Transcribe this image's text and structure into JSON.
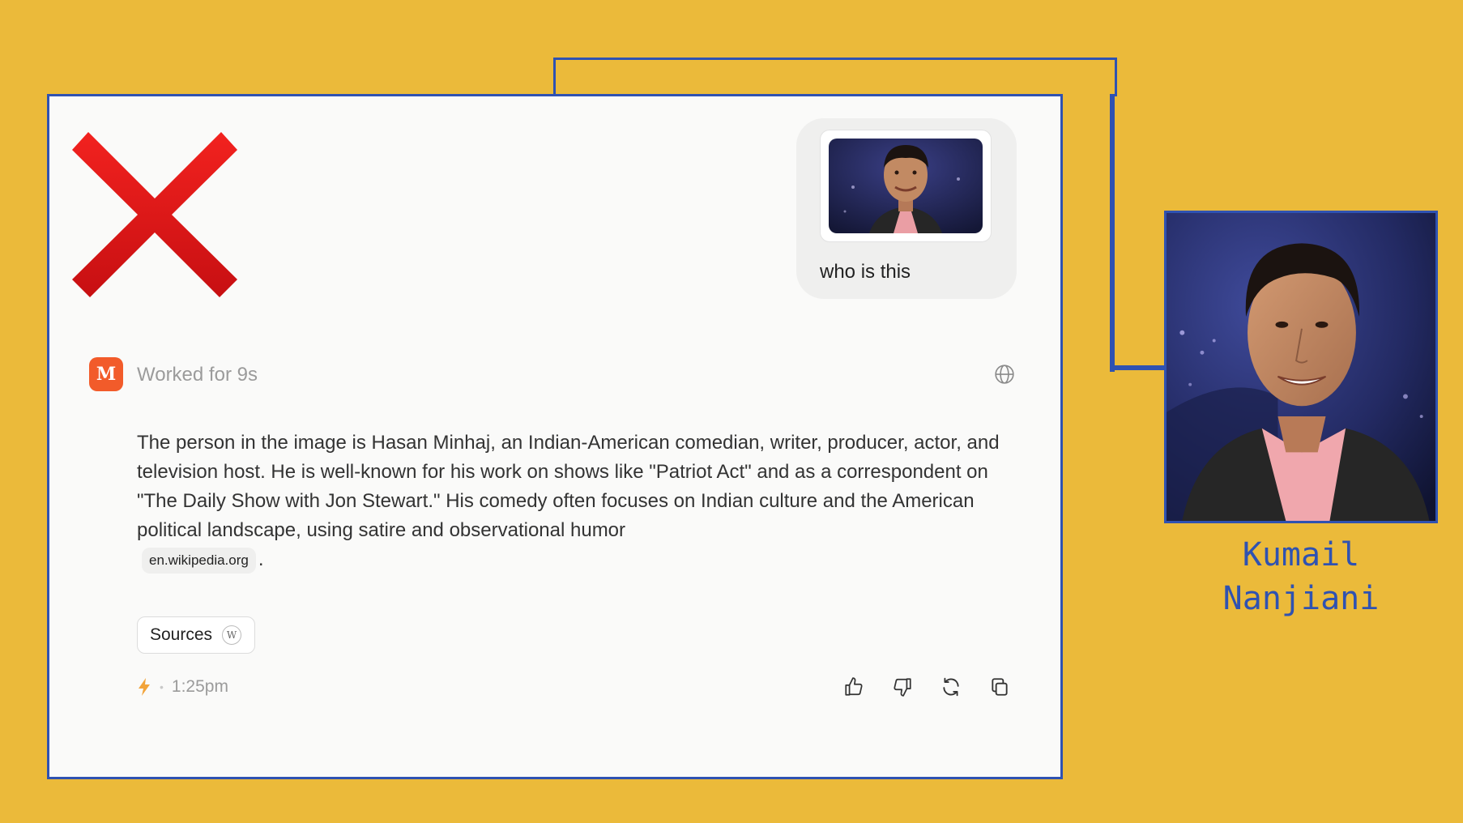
{
  "colors": {
    "background": "#ebba3a",
    "accent_blue": "#2f52b1",
    "wrong_mark": "#e0191d",
    "brand_logo": "#f25b2a",
    "lightning": "#f2a43a"
  },
  "annotation": {
    "verdict_icon": "red-x-icon",
    "correct_name": "Kumail Nanjiani"
  },
  "chat": {
    "user_message": {
      "text": "who is this",
      "image": "thumbnail-photo-of-man"
    },
    "assistant": {
      "logo_icon": "m-logo-icon",
      "status": "Worked for 9s",
      "answer": "The person in the image is Hasan Minhaj, an Indian-American comedian, writer, producer, actor, and television host. He is well-known for his work on shows like \"Patriot Act\" and as a correspondent on \"The Daily Show with Jon Stewart.\" His comedy often focuses on Indian culture and the American political landscape, using satire and observational humor",
      "citation": "en.wikipedia.org",
      "sources_label": "Sources",
      "sources_badge": "W",
      "time": "1:25pm",
      "dot": "•",
      "trailing_period": "."
    }
  }
}
